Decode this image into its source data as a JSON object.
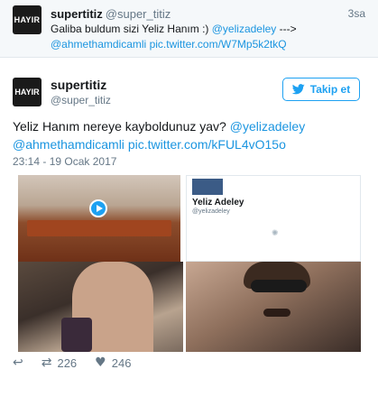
{
  "top_tweet": {
    "avatar_text": "HAYIR",
    "name": "supertitiz",
    "handle": "@super_titiz",
    "time": "3sa",
    "text_plain_1": "Galiba buldum sizi Yeliz Hanım :) ",
    "mention": "@yelizadeley",
    "text_arrow": " --->",
    "mention2": "@ahmethamdicamli",
    "link": "pic.twitter.com/W7Mp5k2tkQ"
  },
  "main_tweet": {
    "avatar_text": "HAYIR",
    "name": "supertitiz",
    "handle": "@super_titiz",
    "follow_label": "Takip et",
    "text_plain": "Yeliz Hanım nereye kayboldunuz yav? ",
    "mention": "@yelizadeley",
    "mention2": "@ahmethamdicamli",
    "link": "pic.twitter.com/kFUL4vO15o",
    "timestamp": "23:14 - 19 Ocak 2017",
    "card_name": "Yeliz Adeley",
    "card_handle": "@yelizadeley",
    "retweets": "226",
    "likes": "246"
  },
  "icons": {
    "follow": "twitter-bird-icon",
    "reply": "reply-icon",
    "retweet": "retweet-icon",
    "like": "heart-icon",
    "play": "play-icon"
  },
  "colors": {
    "link": "#1b95e0",
    "accent": "#1da1f2",
    "muted": "#657786"
  }
}
